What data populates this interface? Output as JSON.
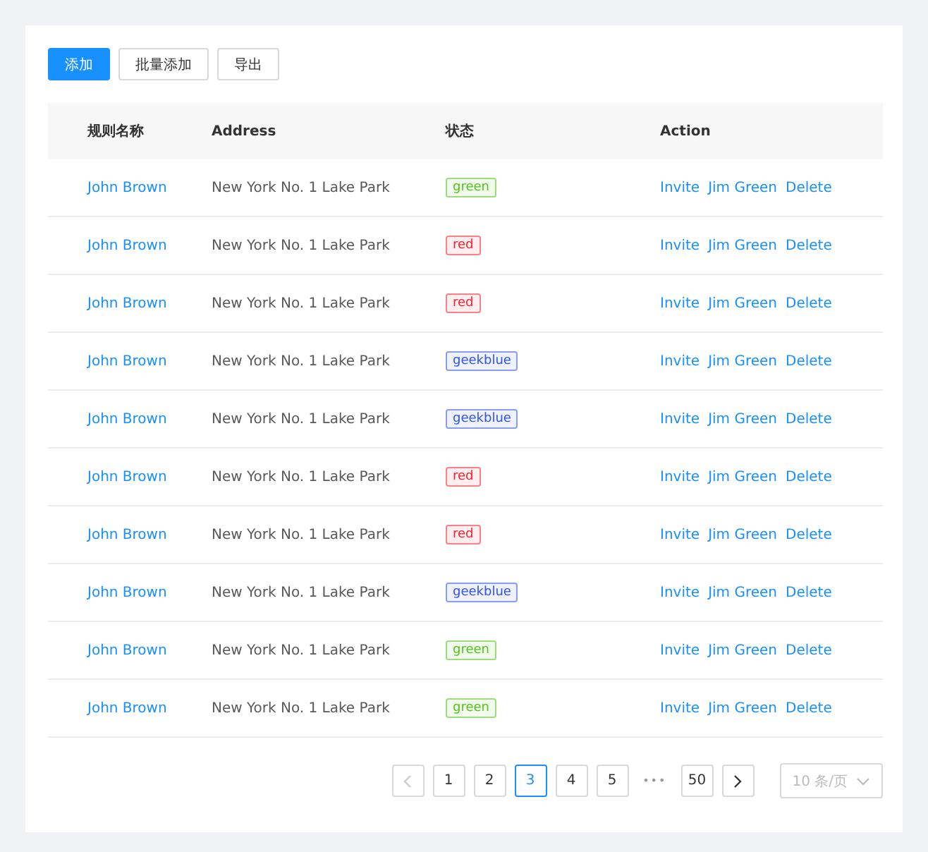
{
  "toolbar": [
    {
      "label": "添加",
      "kind": "primary"
    },
    {
      "label": "批量添加",
      "kind": "default"
    },
    {
      "label": "导出",
      "kind": "default"
    }
  ],
  "table": {
    "columns": [
      "规则名称",
      "Address",
      "状态",
      "Action"
    ],
    "rows": [
      {
        "name": "John Brown",
        "address": "New York No. 1 Lake Park",
        "tag": {
          "text": "green",
          "color": "#52c41a"
        },
        "actions": [
          "Invite",
          "Jim Green",
          "Delete"
        ]
      },
      {
        "name": "John Brown",
        "address": "New York No. 1 Lake Park",
        "tag": {
          "text": "red",
          "color": "#f5222d"
        },
        "actions": [
          "Invite",
          "Jim Green",
          "Delete"
        ]
      },
      {
        "name": "John Brown",
        "address": "New York No. 1 Lake Park",
        "tag": {
          "text": "red",
          "color": "#f5222d"
        },
        "actions": [
          "Invite",
          "Jim Green",
          "Delete"
        ]
      },
      {
        "name": "John Brown",
        "address": "New York No. 1 Lake Park",
        "tag": {
          "text": "geekblue",
          "color": "#2f54eb"
        },
        "actions": [
          "Invite",
          "Jim Green",
          "Delete"
        ]
      },
      {
        "name": "John Brown",
        "address": "New York No. 1 Lake Park",
        "tag": {
          "text": "geekblue",
          "color": "#2f54eb"
        },
        "actions": [
          "Invite",
          "Jim Green",
          "Delete"
        ]
      },
      {
        "name": "John Brown",
        "address": "New York No. 1 Lake Park",
        "tag": {
          "text": "red",
          "color": "#f5222d"
        },
        "actions": [
          "Invite",
          "Jim Green",
          "Delete"
        ]
      },
      {
        "name": "John Brown",
        "address": "New York No. 1 Lake Park",
        "tag": {
          "text": "red",
          "color": "#f5222d"
        },
        "actions": [
          "Invite",
          "Jim Green",
          "Delete"
        ]
      },
      {
        "name": "John Brown",
        "address": "New York No. 1 Lake Park",
        "tag": {
          "text": "geekblue",
          "color": "#2f54eb"
        },
        "actions": [
          "Invite",
          "Jim Green",
          "Delete"
        ]
      },
      {
        "name": "John Brown",
        "address": "New York No. 1 Lake Park",
        "tag": {
          "text": "green",
          "color": "#52c41a"
        },
        "actions": [
          "Invite",
          "Jim Green",
          "Delete"
        ]
      },
      {
        "name": "John Brown",
        "address": "New York No. 1 Lake Park",
        "tag": {
          "text": "green",
          "color": "#52c41a"
        },
        "actions": [
          "Invite",
          "Jim Green",
          "Delete"
        ]
      }
    ]
  },
  "pagination": {
    "prev_disabled": true,
    "pages": [
      {
        "label": "1",
        "selected": false
      },
      {
        "label": "2",
        "selected": false
      },
      {
        "label": "3",
        "selected": true
      },
      {
        "label": "4",
        "selected": false
      },
      {
        "label": "5",
        "selected": false
      }
    ],
    "ellipsis": "•••",
    "last": {
      "label": "50",
      "selected": false
    },
    "page_size": "10 条/页",
    "page_size_disabled": true
  }
}
